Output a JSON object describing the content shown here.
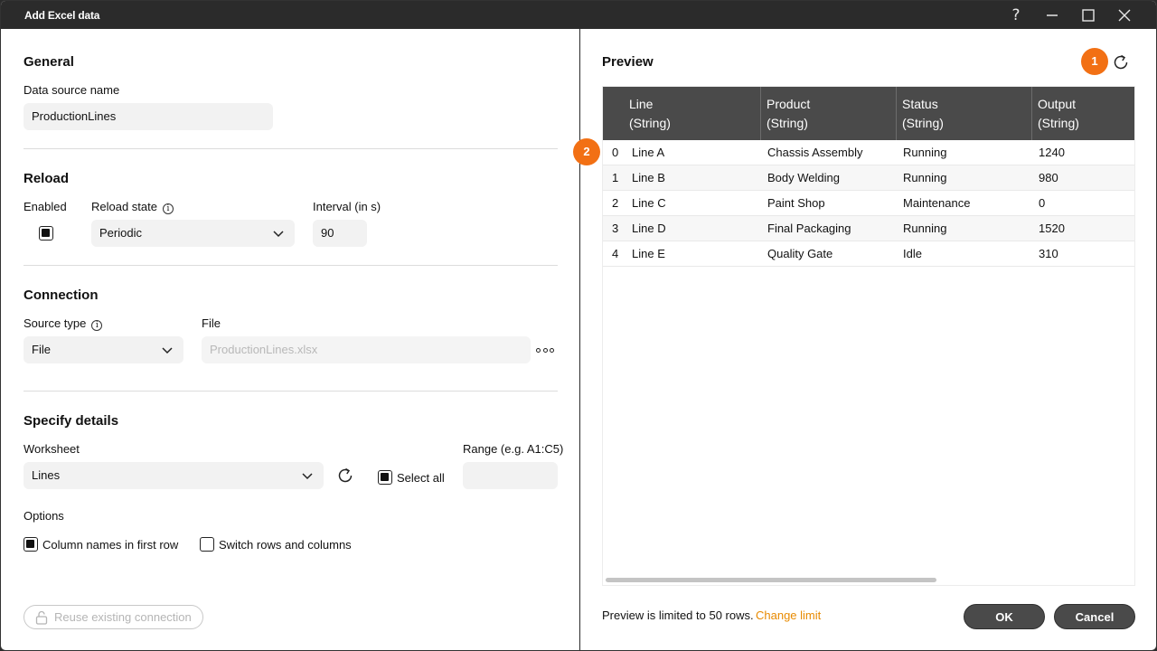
{
  "window": {
    "title": "Add Excel data",
    "help": "?"
  },
  "general": {
    "heading": "General",
    "data_source_label": "Data source name",
    "data_source_value": "ProductionLines"
  },
  "reload": {
    "heading": "Reload",
    "enabled_label": "Enabled",
    "enabled_checked": true,
    "state_label": "Reload state",
    "state_value": "Periodic",
    "interval_label": "Interval (in s)",
    "interval_value": "90"
  },
  "connection": {
    "heading": "Connection",
    "source_type_label": "Source type",
    "source_type_value": "File",
    "file_label": "File",
    "file_placeholder": "ProductionLines.xlsx"
  },
  "details": {
    "heading": "Specify details",
    "worksheet_label": "Worksheet",
    "worksheet_value": "Lines",
    "select_all_label": "Select all",
    "select_all_checked": true,
    "range_label": "Range (e.g. A1:C5)",
    "range_value": "",
    "options_label": "Options",
    "col_names_label": "Column names in first row",
    "col_names_checked": true,
    "switch_label": "Switch rows and columns",
    "switch_checked": false
  },
  "reuse_button": "Reuse existing connection",
  "preview": {
    "heading": "Preview",
    "badge1": "1",
    "badge2": "2",
    "columns": [
      {
        "name": "Line",
        "type": "(String)"
      },
      {
        "name": "Product",
        "type": "(String)"
      },
      {
        "name": "Status",
        "type": "(String)"
      },
      {
        "name": "Output",
        "type": "(String)"
      }
    ],
    "rows": [
      {
        "idx": "0",
        "line": "Line A",
        "product": "Chassis Assembly",
        "status": "Running",
        "output": "1240"
      },
      {
        "idx": "1",
        "line": "Line B",
        "product": "Body Welding",
        "status": "Running",
        "output": "980"
      },
      {
        "idx": "2",
        "line": "Line C",
        "product": "Paint Shop",
        "status": "Maintenance",
        "output": "0"
      },
      {
        "idx": "3",
        "line": "Line D",
        "product": "Final Packaging",
        "status": "Running",
        "output": "1520"
      },
      {
        "idx": "4",
        "line": "Line E",
        "product": "Quality Gate",
        "status": "Idle",
        "output": "310"
      }
    ],
    "limit_text": "Preview is limited to 50 rows.",
    "limit_link": "Change limit"
  },
  "footer": {
    "ok": "OK",
    "cancel": "Cancel"
  },
  "colors": {
    "accent": "#f27014",
    "link": "#e88a00",
    "header_bg": "#4a4a4a",
    "titlebar": "#2b2b2b"
  }
}
